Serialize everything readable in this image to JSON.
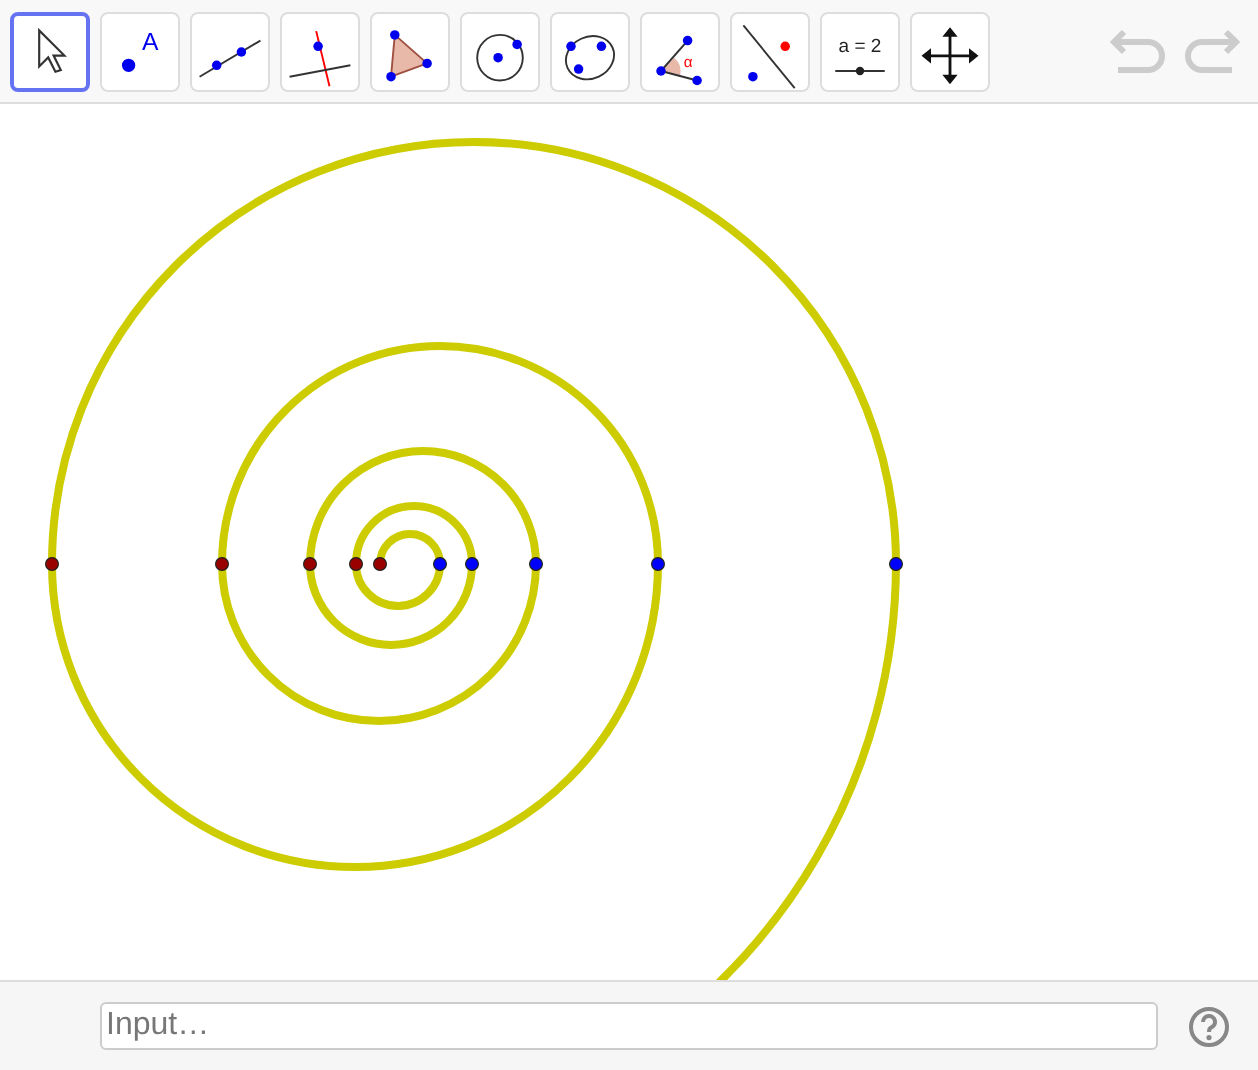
{
  "toolbar": {
    "tools": [
      {
        "kind": "move",
        "selected": true
      },
      {
        "kind": "point",
        "selected": false,
        "label": "A"
      },
      {
        "kind": "line",
        "selected": false
      },
      {
        "kind": "perpendicular",
        "selected": false
      },
      {
        "kind": "polygon",
        "selected": false
      },
      {
        "kind": "circle",
        "selected": false
      },
      {
        "kind": "conic",
        "selected": false
      },
      {
        "kind": "angle",
        "selected": false,
        "label": "α"
      },
      {
        "kind": "reflect",
        "selected": false
      },
      {
        "kind": "slider",
        "selected": false,
        "label": "a = 2"
      },
      {
        "kind": "pan",
        "selected": false
      }
    ],
    "undo": {
      "disabled": true
    },
    "redo": {
      "disabled": true
    }
  },
  "graphics": {
    "points": [
      {
        "color": "#990000"
      },
      {
        "color": "#990000"
      },
      {
        "color": "#990000"
      },
      {
        "color": "#990000"
      },
      {
        "color": "#990000"
      },
      {
        "color": "#0000ff"
      },
      {
        "color": "#0000ff"
      },
      {
        "color": "#0000ff"
      },
      {
        "color": "#0000ff"
      },
      {
        "color": "#0000ff"
      }
    ]
  },
  "input_bar": {
    "placeholder": "Input…"
  }
}
